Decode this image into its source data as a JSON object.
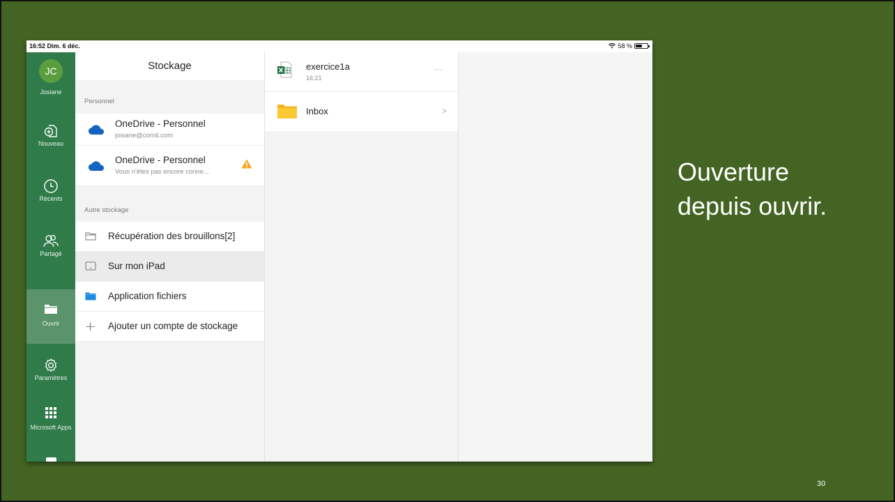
{
  "status_bar": {
    "time": "16:52  Dim. 6 déc.",
    "battery": "58 %",
    "battery_level": 0.58
  },
  "rail": {
    "avatar_initials": "JC",
    "user_name": "Josiane",
    "items": [
      {
        "label": "Nouveau",
        "icon": "new-file-icon"
      },
      {
        "label": "Récents",
        "icon": "clock-icon"
      },
      {
        "label": "Partagé",
        "icon": "people-icon"
      },
      {
        "label": "Ouvrir",
        "icon": "folder-icon"
      },
      {
        "label": "Paramètres",
        "icon": "gear-icon"
      },
      {
        "label": "Microsoft Apps",
        "icon": "apps-grid-icon"
      }
    ]
  },
  "stockage": {
    "title": "Stockage",
    "personal_label": "Personnel",
    "accounts": [
      {
        "title": "OneDrive - Personnel",
        "subtitle": "josiane@cornil.com"
      },
      {
        "title": "OneDrive - Personnel",
        "subtitle": "Vous n'êtes pas encore conne..."
      }
    ],
    "other_label": "Autre stockage",
    "other_items": [
      {
        "title": "Récupération des brouillons[2]",
        "icon": "folder-outline-icon"
      },
      {
        "title": "Sur mon iPad",
        "icon": "ipad-icon"
      },
      {
        "title": "Application fichiers",
        "icon": "files-app-icon"
      },
      {
        "title": "Ajouter un compte de stockage",
        "icon": "plus-icon"
      }
    ]
  },
  "files": {
    "items": [
      {
        "name": "exercice1a",
        "meta": "16:21",
        "action": "···"
      },
      {
        "name": "Inbox",
        "action": ">"
      }
    ]
  },
  "slide": {
    "heading": "Ouverture depuis ouvrir.",
    "page_number": "30"
  },
  "colors": {
    "background": "#436423",
    "rail": "#2f7b4a",
    "onedrive": "#1565c0",
    "warning": "#f5a623",
    "excel": "#1d7044"
  }
}
